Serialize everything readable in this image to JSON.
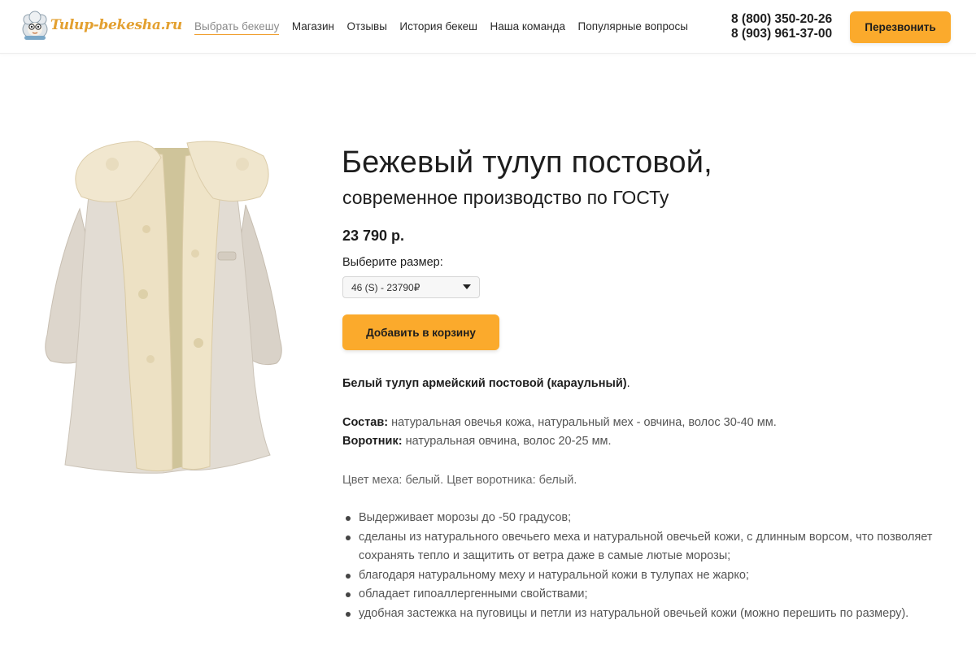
{
  "header": {
    "logo_text": "Tulup-bekesha.ru",
    "nav": [
      {
        "label": "Выбрать бекешу",
        "active": true
      },
      {
        "label": "Магазин",
        "active": false
      },
      {
        "label": "Отзывы",
        "active": false
      },
      {
        "label": "История бекеш",
        "active": false
      },
      {
        "label": "Наша команда",
        "active": false
      },
      {
        "label": "Популярные вопросы",
        "active": false
      }
    ],
    "phones": [
      "8 (800) 350-20-26",
      "8 (903) 961-37-00"
    ],
    "callback_label": "Перезвонить"
  },
  "product": {
    "title": "Бежевый тулуп постовой,",
    "subtitle": "современное производство по ГОСТу",
    "price": "23 790 р.",
    "size_label": "Выберите размер:",
    "size_selected": "46 (S) - 23790₽",
    "add_to_cart_label": "Добавить в корзину",
    "lead": "Белый тулуп армейский постовой (караульный)",
    "lead_end": ".",
    "composition_label": "Состав:",
    "composition_value": " натуральная овечья кожа, натуральный мех - овчина, волос 30-40 мм.",
    "collar_label": "Воротник:",
    "collar_value": " натуральная овчина, волос 20-25 мм.",
    "colors": "Цвет меха: белый. Цвет воротника: белый.",
    "features": [
      "Выдерживает морозы до -50 градусов;",
      "сделаны из натурального овечьего меха и натуральной овечьей кожи, с длинным ворсом, что позволяет сохранять тепло и защитить от ветра даже в самые лютые морозы;",
      "благодаря натуральному меху и натуральной кожи в тулупах не жарко;",
      "обладает гипоаллергенными свойствами;",
      "удобная застежка на пуговицы и петли из натуральной овечьей кожи (можно перешить по размеру)."
    ]
  },
  "icons": {
    "logo": "sheep-mascot-icon",
    "select_caret": "chevron-down-icon"
  },
  "colors": {
    "accent": "#fbaa2c",
    "logo": "#e3a030",
    "text": "#1d1d1d"
  }
}
